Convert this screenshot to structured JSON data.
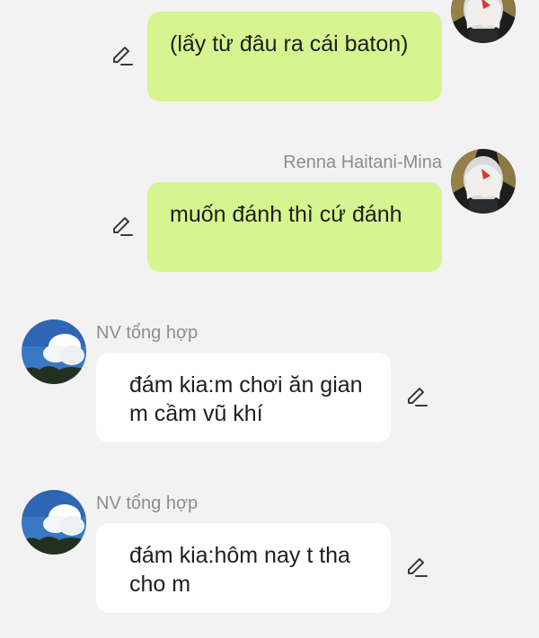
{
  "chat": {
    "messages": [
      {
        "side": "right",
        "sender": "",
        "text": "(lấy từ đâu ra cái baton)"
      },
      {
        "side": "right",
        "sender": "Renna Haitani-Mina",
        "text": "muốn đánh thì cứ đánh"
      },
      {
        "side": "left",
        "sender": "NV tổng hợp",
        "text": "đám kia:m chơi ăn gian m cầm vũ khí"
      },
      {
        "side": "left",
        "sender": "NV tổng hợp",
        "text": "đám kia:hôm nay t tha cho m"
      }
    ]
  },
  "icons": {
    "edit": "pencil-edit-icon",
    "avatar_right": "anime-character-avatar",
    "avatar_left": "sky-cloud-avatar"
  },
  "colors": {
    "background": "#f2f2f2",
    "my_bubble": "#d6f590",
    "other_bubble": "#ffffff",
    "sender_name": "#8d8d8d",
    "message_text": "#1e1e1e"
  }
}
